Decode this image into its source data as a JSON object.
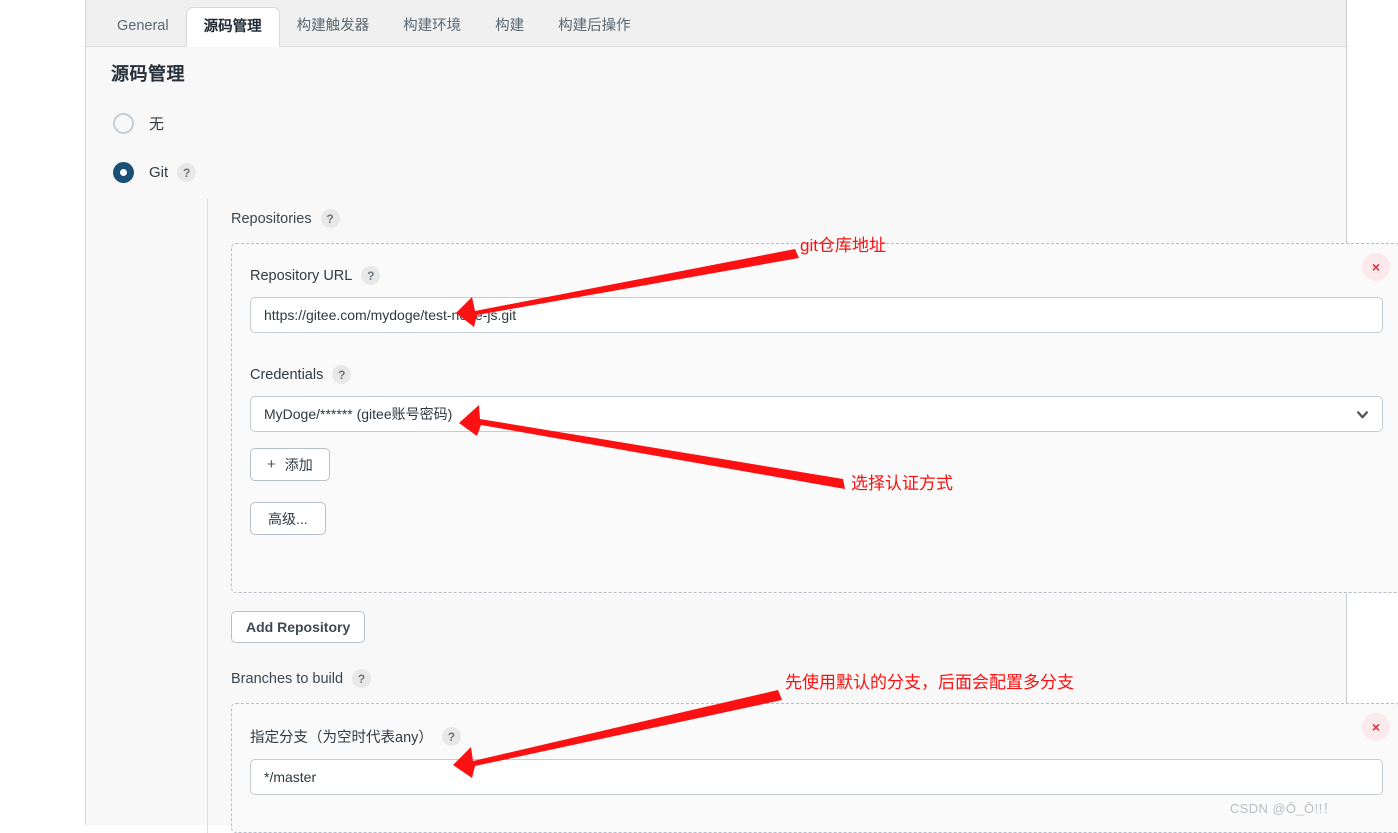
{
  "tabs": [
    {
      "label": "General",
      "active": false
    },
    {
      "label": "源码管理",
      "active": true
    },
    {
      "label": "构建触发器",
      "active": false
    },
    {
      "label": "构建环境",
      "active": false
    },
    {
      "label": "构建",
      "active": false
    },
    {
      "label": "构建后操作",
      "active": false
    }
  ],
  "page_title": "源码管理",
  "scm": {
    "options": [
      {
        "label": "无",
        "selected": false
      },
      {
        "label": "Git",
        "selected": true,
        "help": "?"
      }
    ]
  },
  "repositories": {
    "section_label": "Repositories",
    "section_help": "?",
    "repo_url": {
      "label": "Repository URL",
      "help": "?",
      "value": "https://gitee.com/mydoge/test-node-js.git"
    },
    "credentials": {
      "label": "Credentials",
      "help": "?",
      "value": "MyDoge/****** (gitee账号密码)",
      "chevron": "chevron-down-icon"
    },
    "add_credential_button": {
      "icon": "plus-icon",
      "label": "添加"
    },
    "advanced_button": {
      "label": "高级..."
    },
    "delete_icon": "×",
    "add_repository_button": {
      "label": "Add Repository"
    }
  },
  "branches": {
    "section_label": "Branches to build",
    "section_help": "?",
    "branch_spec": {
      "label": "指定分支（为空时代表any）",
      "help": "?",
      "value": "*/master"
    },
    "delete_icon": "×"
  },
  "annotations": [
    {
      "text": "git仓库地址",
      "color": "#fb1111"
    },
    {
      "text": "选择认证方式",
      "color": "#fb1111"
    },
    {
      "text": "先使用默认的分支，后面会配置多分支",
      "color": "#fb1111"
    }
  ],
  "watermark": "CSDN @Ō_Ō!!！",
  "colors": {
    "accent": "#1a4f76",
    "annotation": "#fb1111",
    "panel_bg": "#f8f8f8",
    "tab_bar_bg": "#f0f0f0"
  }
}
